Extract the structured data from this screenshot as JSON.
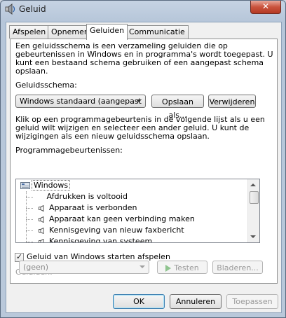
{
  "window": {
    "title": "Geluid",
    "close_glyph": "✕"
  },
  "tabs": [
    {
      "label": "Afspelen"
    },
    {
      "label": "Opnemen"
    },
    {
      "label": "Geluiden",
      "active": true
    },
    {
      "label": "Communicatie"
    }
  ],
  "intro_text": "Een geluidsschema is een verzameling geluiden die op\ngebeurtenissen in Windows en in programma's wordt toegepast.  U\nkunt een bestaand schema gebruiken of een aangepast schema\nopslaan.",
  "scheme": {
    "label": "Geluidsschema:",
    "selected": "Windows standaard (aangepast",
    "save_button": "Opslaan als...",
    "delete_button": "Verwijderen"
  },
  "instruction_text": "Klik op een programmagebeurtenis in de volgende lijst als u een\ngeluid wilt wijzigen en selecteer een ander geluid.  U kunt de\nwijzigingen als een nieuw geluidsschema opslaan.",
  "events": {
    "label": "Programmagebeurtenissen:",
    "group": "Windows",
    "items": [
      {
        "label": "Afdrukken is voltooid",
        "has_sound": false
      },
      {
        "label": "Apparaat is verbonden",
        "has_sound": true
      },
      {
        "label": "Apparaat kan geen verbinding maken",
        "has_sound": true
      },
      {
        "label": "Kennisgeving van nieuw faxbericht",
        "has_sound": true
      },
      {
        "label": "Kennisgeving van systeem",
        "has_sound": true
      }
    ]
  },
  "startup_checkbox": {
    "label": "Geluid van Windows starten afspelen",
    "checked": true
  },
  "sounds": {
    "label": "Geluiden:",
    "selected": "(geen)",
    "test_button": "Testen",
    "browse_button": "Bladeren..."
  },
  "footer": {
    "ok": "OK",
    "cancel": "Annuleren",
    "apply": "Toepassen"
  },
  "colors": {
    "accent": "#3c7fb1",
    "play_green": "#47a447"
  }
}
